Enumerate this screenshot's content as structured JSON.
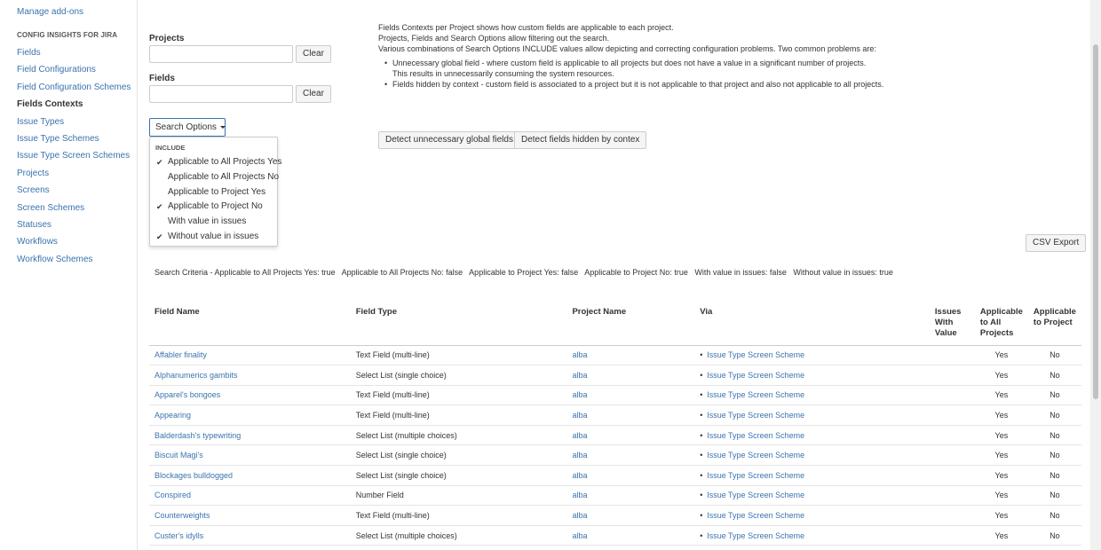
{
  "sidebar": {
    "manage_addons": "Manage add-ons",
    "heading": "CONFIG INSIGHTS FOR JIRA",
    "items": [
      {
        "label": "Fields"
      },
      {
        "label": "Field Configurations"
      },
      {
        "label": "Field Configuration Schemes"
      },
      {
        "label": "Fields Contexts",
        "active": true
      },
      {
        "label": "Issue Types"
      },
      {
        "label": "Issue Type Schemes"
      },
      {
        "label": "Issue Type Screen Schemes"
      },
      {
        "label": "Projects"
      },
      {
        "label": "Screens"
      },
      {
        "label": "Screen Schemes"
      },
      {
        "label": "Statuses"
      },
      {
        "label": "Workflows"
      },
      {
        "label": "Workflow Schemes"
      }
    ]
  },
  "filters": {
    "projects_label": "Projects",
    "projects_value": "",
    "fields_label": "Fields",
    "fields_value": "",
    "clear_label": "Clear",
    "search_options_label": "Search Options"
  },
  "dropdown": {
    "heading": "INCLUDE",
    "items": [
      {
        "label": "Applicable to All Projects Yes",
        "checked": true
      },
      {
        "label": "Applicable to All Projects No",
        "checked": false
      },
      {
        "label": "Applicable to Project Yes",
        "checked": false
      },
      {
        "label": "Applicable to Project No",
        "checked": true
      },
      {
        "label": "With value in issues",
        "checked": false
      },
      {
        "label": "Without value in issues",
        "checked": true
      }
    ]
  },
  "info": {
    "line1": "Fields Contexts per Project shows how custom fields are applicable to each project.",
    "line2": "Projects, Fields and Search Options allow filtering out the search.",
    "line3": "Various combinations of Search Options INCLUDE values allow depicting and correcting configuration problems. Two common problems are:",
    "bullet1a": "Unnecessary global field - where custom field is applicable to all projects but does not have a value in a significant number of projects.",
    "bullet1b": "This results in unnecessarily consuming the system resources.",
    "bullet2": "Fields hidden by context - custom field is associated to a project but it is not applicable to that project and also not applicable to all projects."
  },
  "actions": {
    "detect_global": "Detect unnecessary global fields",
    "detect_hidden": "Detect fields hidden by contex",
    "csv_export": "CSV Export"
  },
  "criteria": "Search Criteria - Applicable to All Projects Yes: true   Applicable to All Projects No: false   Applicable to Project Yes: false   Applicable to Project No: true   With value in issues: false   Without value in issues: true",
  "table": {
    "headers": {
      "field_name": "Field Name",
      "field_type": "Field Type",
      "project_name": "Project Name",
      "via": "Via",
      "issues_with_value": "Issues With Value",
      "applicable_all": "Applicable to All Projects",
      "applicable_project": "Applicable to Project"
    },
    "rows": [
      {
        "field": "Affabler finality",
        "type": "Text Field (multi-line)",
        "project": "alba",
        "via": "Issue Type Screen Scheme",
        "issues": "",
        "all": "Yes",
        "proj": "No"
      },
      {
        "field": "Alphanumerics gambits",
        "type": "Select List (single choice)",
        "project": "alba",
        "via": "Issue Type Screen Scheme",
        "issues": "",
        "all": "Yes",
        "proj": "No"
      },
      {
        "field": "Apparel's bongoes",
        "type": "Text Field (multi-line)",
        "project": "alba",
        "via": "Issue Type Screen Scheme",
        "issues": "",
        "all": "Yes",
        "proj": "No"
      },
      {
        "field": "Appearing",
        "type": "Text Field (multi-line)",
        "project": "alba",
        "via": "Issue Type Screen Scheme",
        "issues": "",
        "all": "Yes",
        "proj": "No"
      },
      {
        "field": "Balderdash's typewriting",
        "type": "Select List (multiple choices)",
        "project": "alba",
        "via": "Issue Type Screen Scheme",
        "issues": "",
        "all": "Yes",
        "proj": "No"
      },
      {
        "field": "Biscuit Magi's",
        "type": "Select List (single choice)",
        "project": "alba",
        "via": "Issue Type Screen Scheme",
        "issues": "",
        "all": "Yes",
        "proj": "No"
      },
      {
        "field": "Blockages bulldogged",
        "type": "Select List (single choice)",
        "project": "alba",
        "via": "Issue Type Screen Scheme",
        "issues": "",
        "all": "Yes",
        "proj": "No"
      },
      {
        "field": "Conspired",
        "type": "Number Field",
        "project": "alba",
        "via": "Issue Type Screen Scheme",
        "issues": "",
        "all": "Yes",
        "proj": "No"
      },
      {
        "field": "Counterweights",
        "type": "Text Field (multi-line)",
        "project": "alba",
        "via": "Issue Type Screen Scheme",
        "issues": "",
        "all": "Yes",
        "proj": "No"
      },
      {
        "field": "Custer's idylls",
        "type": "Select List (multiple choices)",
        "project": "alba",
        "via": "Issue Type Screen Scheme",
        "issues": "",
        "all": "Yes",
        "proj": "No"
      }
    ]
  }
}
